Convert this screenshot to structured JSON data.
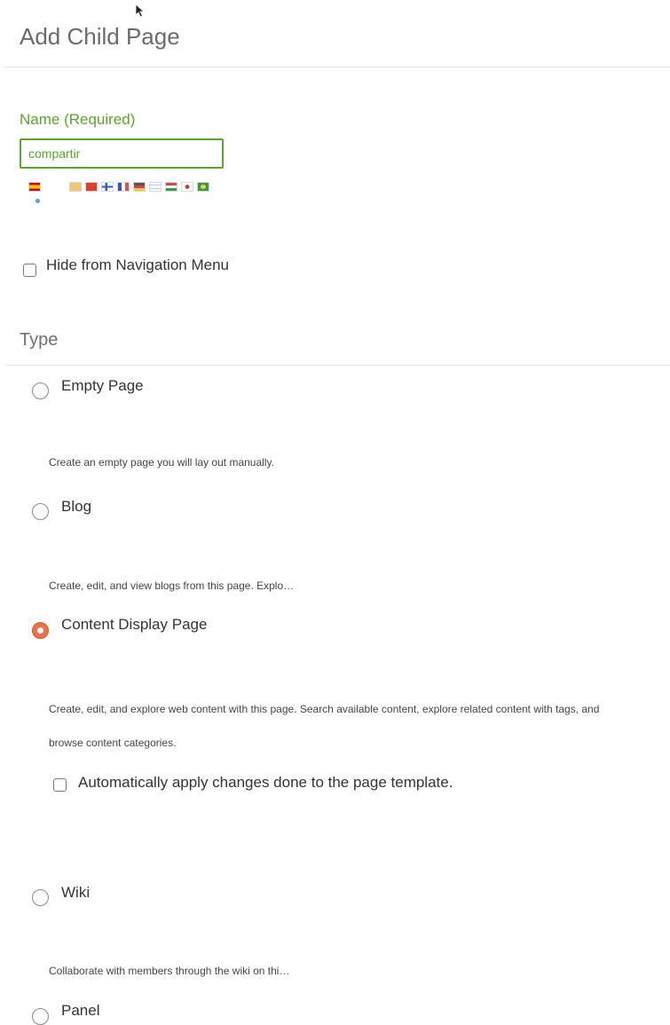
{
  "header": {
    "title": "Add Child Page"
  },
  "name_field": {
    "label": "Name (Required)",
    "value": "compartir"
  },
  "languages": {
    "flags": [
      "flag-es",
      "flag-es-variant",
      "flag-cn",
      "flag-fi",
      "flag-fr",
      "flag-de",
      "flag-il",
      "flag-hu",
      "flag-jp",
      "flag-br"
    ]
  },
  "options": {
    "hide_nav_label": "Hide from Navigation Menu",
    "hide_nav_checked": false
  },
  "type_section": {
    "title": "Type",
    "selected": "Content Display Page",
    "types": [
      {
        "label": "Empty Page",
        "description": "Create an empty page you will lay out manually."
      },
      {
        "label": "Blog",
        "description": "Create, edit, and view blogs from this page. Explo…"
      },
      {
        "label": "Content Display Page",
        "description": "Create, edit, and explore web content with this page. Search available content, explore related content with tags, and browse content categories."
      },
      {
        "label": "Wiki",
        "description": "Collaborate with members through the wiki on thi…"
      },
      {
        "label": "Panel"
      }
    ],
    "template_checkbox": {
      "label": "Automatically apply changes done to the page template.",
      "checked": false
    }
  },
  "colors": {
    "accent_green": "#5aa52a",
    "radio_selected": "#ef6f46",
    "title_gray": "#6b6b6b"
  }
}
